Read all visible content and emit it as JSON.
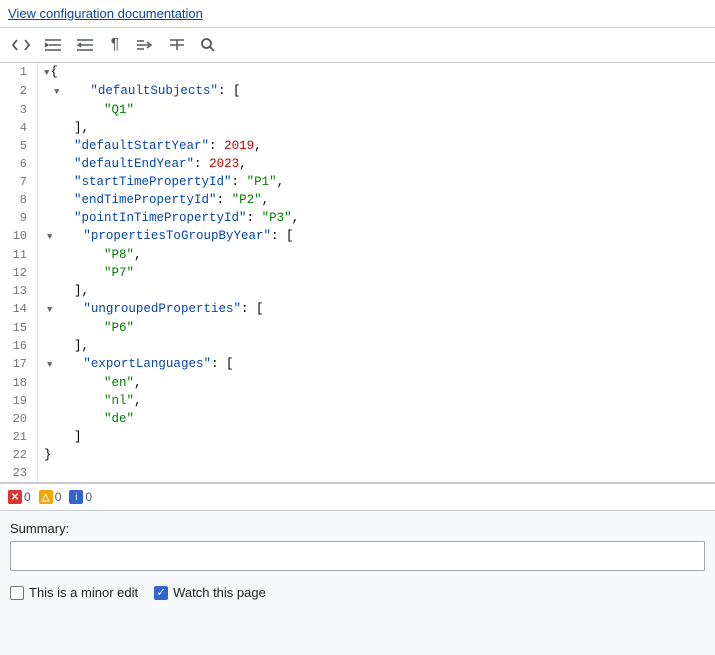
{
  "header": {
    "doc_link": "View configuration documentation"
  },
  "toolbar": {
    "buttons": [
      {
        "name": "code-toggle-btn",
        "icon": "<>",
        "label": "Toggle code"
      },
      {
        "name": "indent-btn",
        "icon": "≡→",
        "label": "Indent"
      },
      {
        "name": "outdent-btn",
        "icon": "←≡",
        "label": "Outdent"
      },
      {
        "name": "paragraph-btn",
        "icon": "¶",
        "label": "Paragraph"
      },
      {
        "name": "format-btn",
        "icon": "⇒",
        "label": "Format"
      },
      {
        "name": "menu-btn",
        "icon": "☰→",
        "label": "Menu"
      },
      {
        "name": "search-btn",
        "icon": "🔍",
        "label": "Search"
      }
    ]
  },
  "code_lines": [
    {
      "num": "1",
      "fold": true,
      "content": "{"
    },
    {
      "num": "2",
      "fold": true,
      "content": "    \"defaultSubjects\": ["
    },
    {
      "num": "3",
      "fold": false,
      "content": "        \"Q1\""
    },
    {
      "num": "4",
      "fold": false,
      "content": "    ],"
    },
    {
      "num": "5",
      "fold": false,
      "content": "    \"defaultStartYear\": 2019,"
    },
    {
      "num": "6",
      "fold": false,
      "content": "    \"defaultEndYear\": 2023,"
    },
    {
      "num": "7",
      "fold": false,
      "content": "    \"startTimePropertyId\": \"P1\","
    },
    {
      "num": "8",
      "fold": false,
      "content": "    \"endTimePropertyId\": \"P2\","
    },
    {
      "num": "9",
      "fold": false,
      "content": "    \"pointInTimePropertyId\": \"P3\","
    },
    {
      "num": "10",
      "fold": true,
      "content": "    \"propertiesToGroupByYear\": ["
    },
    {
      "num": "11",
      "fold": false,
      "content": "        \"P8\","
    },
    {
      "num": "12",
      "fold": false,
      "content": "        \"P7\""
    },
    {
      "num": "13",
      "fold": false,
      "content": "    ],"
    },
    {
      "num": "14",
      "fold": true,
      "content": "    \"ungroupedProperties\": ["
    },
    {
      "num": "15",
      "fold": false,
      "content": "        \"P6\""
    },
    {
      "num": "16",
      "fold": false,
      "content": "    ],"
    },
    {
      "num": "17",
      "fold": true,
      "content": "    \"exportLanguages\": ["
    },
    {
      "num": "18",
      "fold": false,
      "content": "        \"en\","
    },
    {
      "num": "19",
      "fold": false,
      "content": "        \"nl\","
    },
    {
      "num": "20",
      "fold": false,
      "content": "        \"de\""
    },
    {
      "num": "21",
      "fold": false,
      "content": "    ]"
    },
    {
      "num": "22",
      "fold": false,
      "content": "}"
    },
    {
      "num": "23",
      "fold": false,
      "content": ""
    }
  ],
  "status_bar": {
    "errors": "0",
    "warnings": "0",
    "info": "0"
  },
  "summary": {
    "label": "Summary:",
    "placeholder": "",
    "value": ""
  },
  "options": {
    "minor_edit_label": "This is a minor edit",
    "watch_label": "Watch this page",
    "minor_checked": false,
    "watch_checked": true
  }
}
